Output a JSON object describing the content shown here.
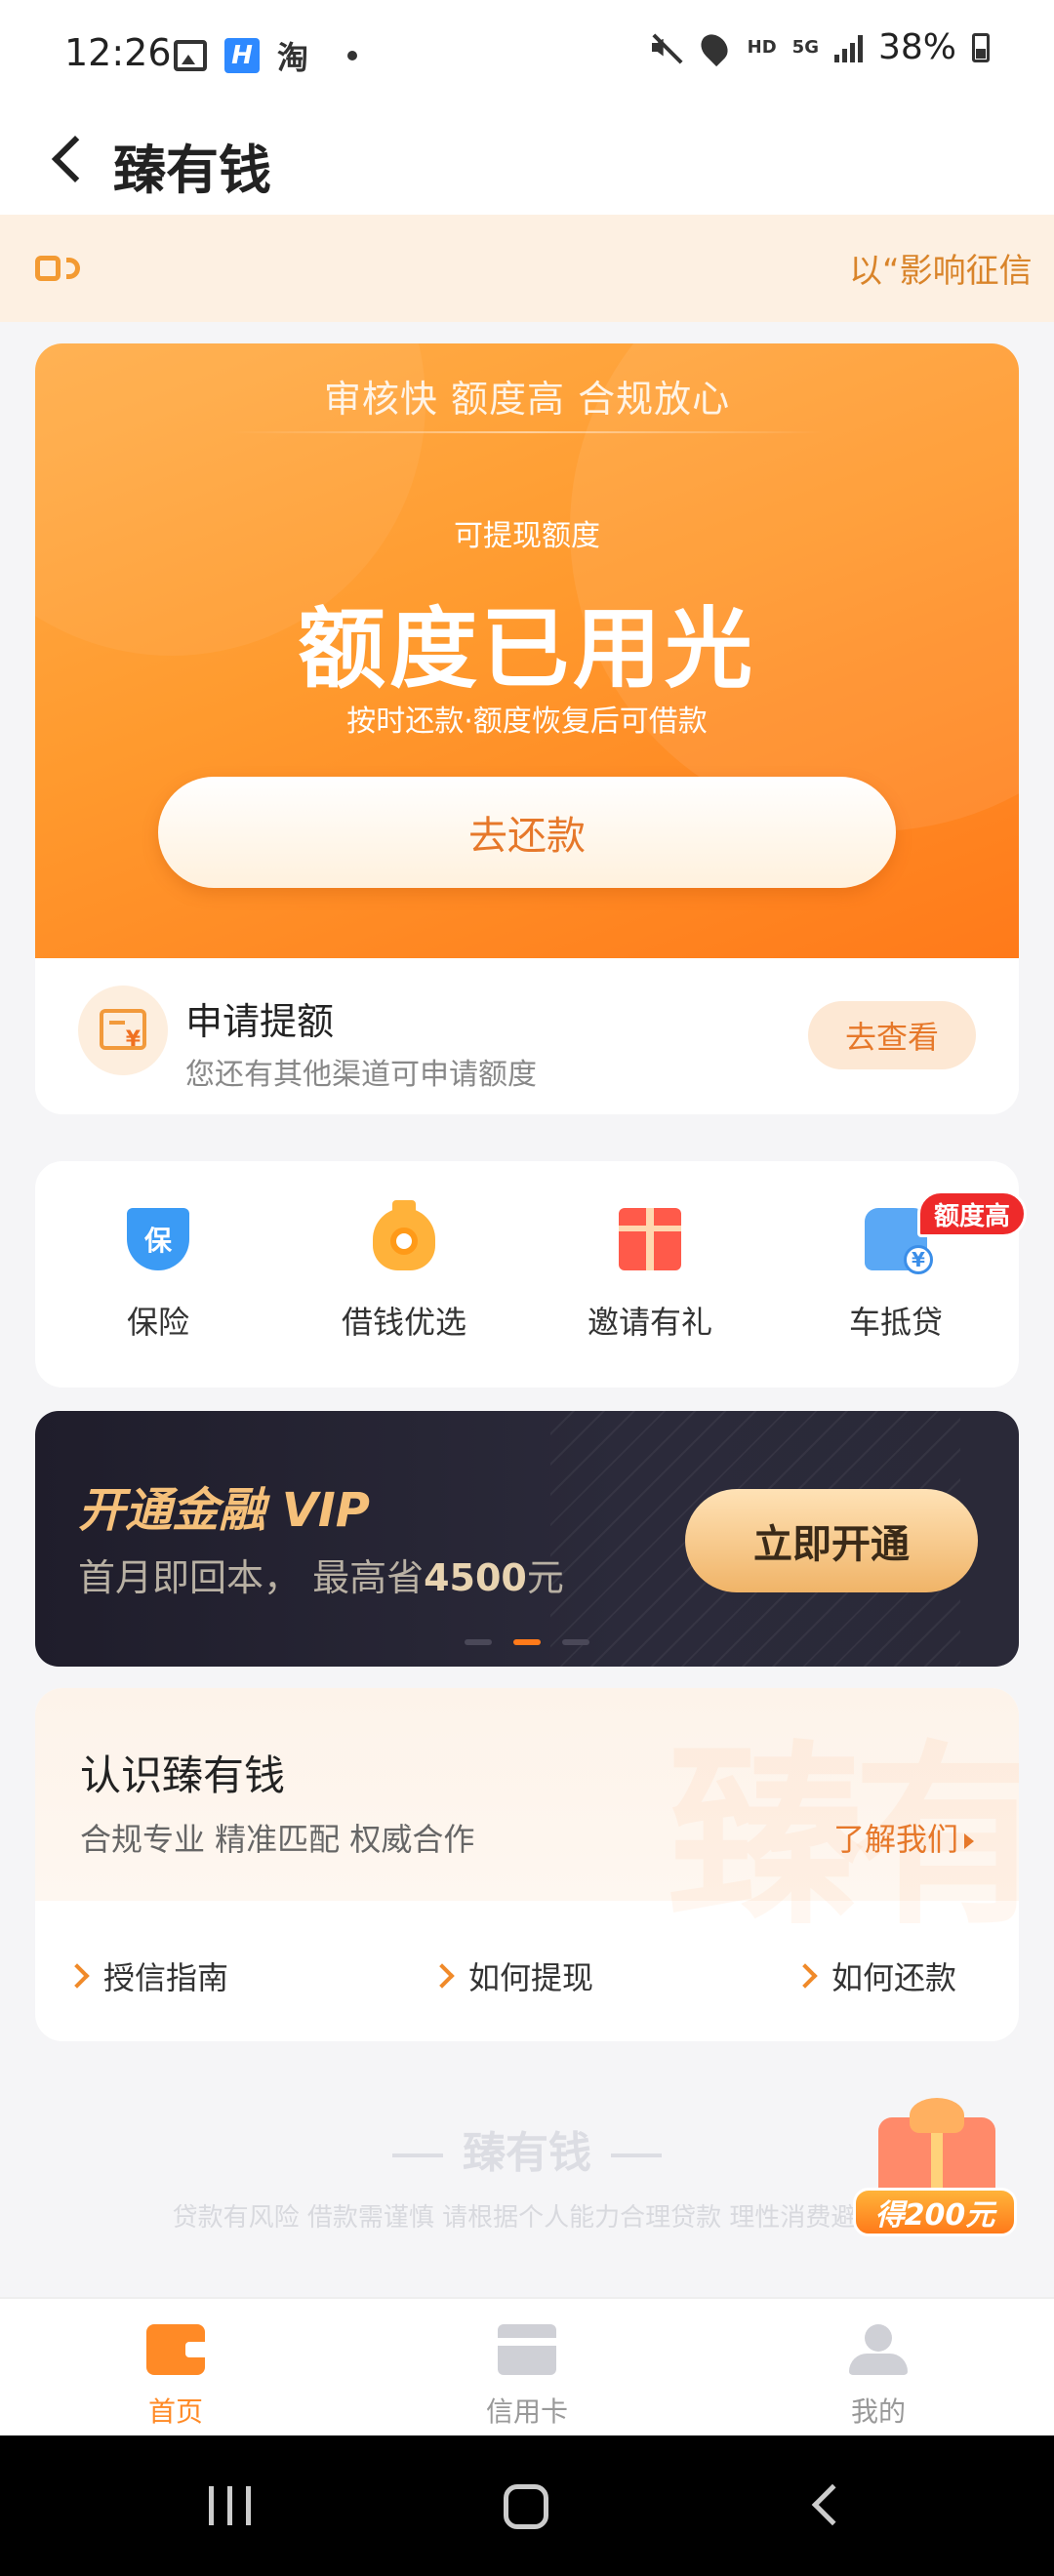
{
  "status_bar": {
    "time": "12:26",
    "left_icons": [
      "gallery-icon",
      "h-app-icon",
      "taobao-icon",
      "dot"
    ],
    "taobao_char": "淘",
    "h_char": "H",
    "hd": "HD",
    "network": "5G",
    "battery": "38%"
  },
  "header": {
    "title": "臻有钱"
  },
  "notice": {
    "text": "以“影响征信"
  },
  "credit": {
    "tagline": "审核快 额度高 合规放心",
    "limit_label": "可提现额度",
    "limit_status": "额度已用光",
    "limit_hint": "按时还款·额度恢复后可借款",
    "repay_button": "去还款",
    "raise_title": "申请提额",
    "raise_subtitle": "您还有其他渠道可申请额度",
    "view_button": "去查看"
  },
  "quick_menu": {
    "items": [
      {
        "label": "保险",
        "icon": "insurance-shield-icon",
        "glyph": "保"
      },
      {
        "label": "借钱优选",
        "icon": "money-bag-icon"
      },
      {
        "label": "邀请有礼",
        "icon": "gift-icon"
      },
      {
        "label": "车抵贷",
        "icon": "car-loan-icon",
        "badge": "额度高"
      }
    ]
  },
  "vip_banner": {
    "title": "开通金融 VIP",
    "subtitle_prefix": "首月即回本， 最高省",
    "subtitle_amount": "4500",
    "subtitle_suffix": "元",
    "button": "立即开通",
    "dots_count": 3,
    "active_dot": 1
  },
  "about": {
    "title": "认识臻有钱",
    "subtitle": "合规专业 精准匹配 权威合作",
    "link": "了解我们",
    "guides": [
      "授信指南",
      "如何提现",
      "如何还款"
    ]
  },
  "footer": {
    "logo": "臻有钱",
    "disclaimer": "贷款有风险 借款需谨慎 请根据个人能力合理贷款 理性消费避免"
  },
  "float_gift": {
    "label": "得200元"
  },
  "tabs": [
    {
      "label": "首页",
      "icon": "wallet-icon",
      "active": true
    },
    {
      "label": "信用卡",
      "icon": "credit-card-icon",
      "active": false
    },
    {
      "label": "我的",
      "icon": "user-icon",
      "active": false
    }
  ],
  "colors": {
    "accent": "#ff8a26",
    "tab_active": "#ff8a26",
    "tab_inactive": "#999999",
    "badge": "#ee2a2a"
  }
}
